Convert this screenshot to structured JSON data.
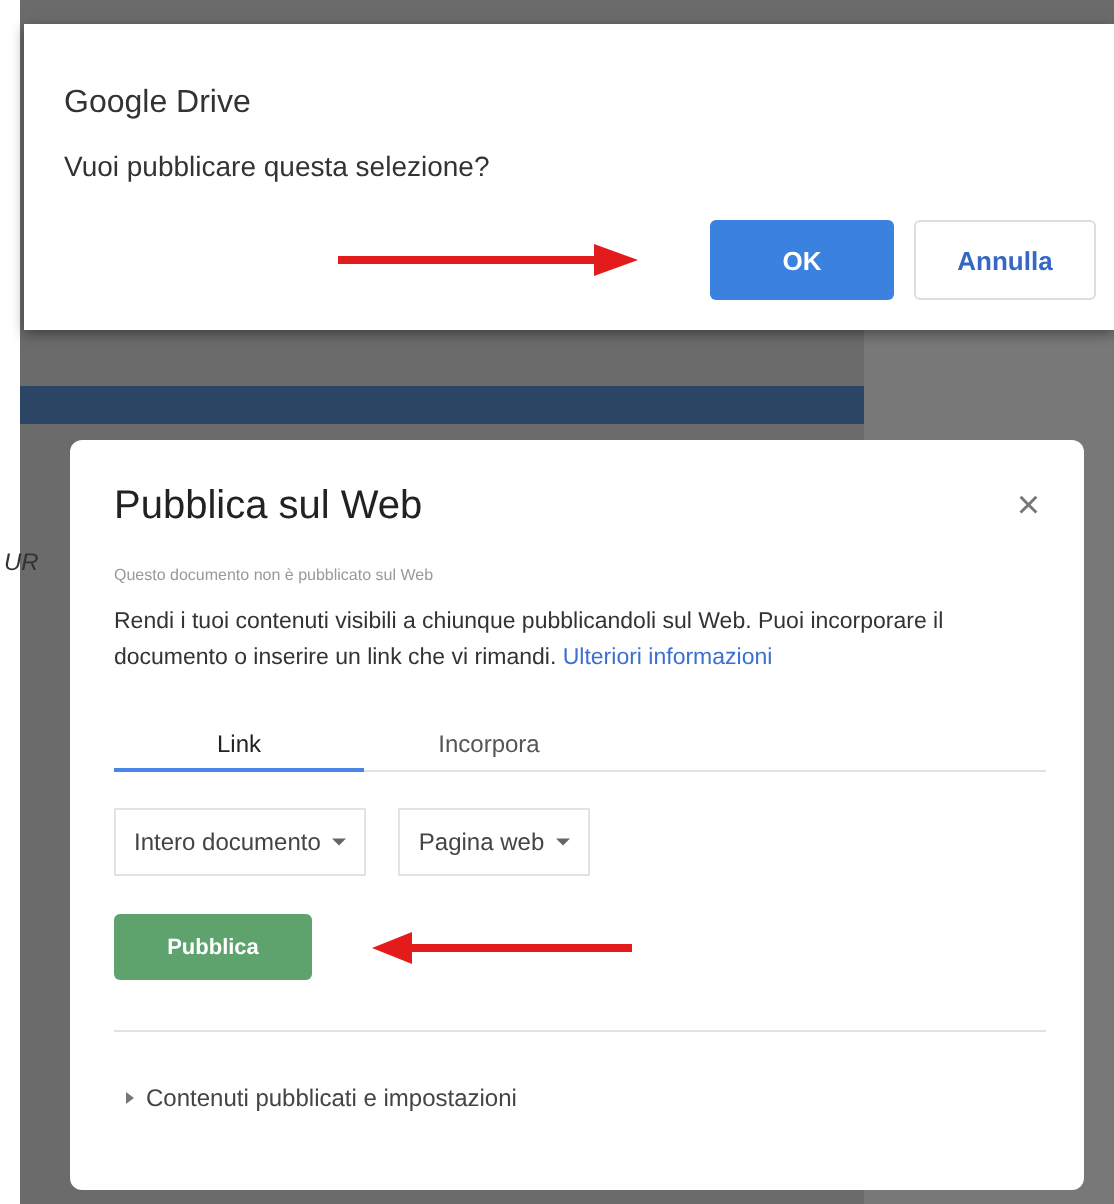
{
  "background": {
    "partial_text": "UR"
  },
  "confirm_dialog": {
    "title": "Google Drive",
    "message": "Vuoi pubblicare questa selezione?",
    "buttons": [
      {
        "label": "OK",
        "kind": "primary"
      },
      {
        "label": "Annulla",
        "kind": "secondary"
      }
    ]
  },
  "publish_dialog": {
    "title": "Pubblica sul Web",
    "close": "×",
    "status": "Questo documento non è pubblicato sul Web",
    "description": "Rendi i tuoi contenuti visibili a chiunque pubblicandoli sul Web. Puoi incorporare il documento o inserire un link che vi rimandi.",
    "link": "Ulteriori informazioni",
    "tabs": [
      {
        "label": "Link",
        "selected": true
      },
      {
        "label": "Incorpora",
        "selected": false
      }
    ],
    "dropdowns": [
      {
        "value": "Intero documento"
      },
      {
        "value": "Pagina web"
      }
    ],
    "publish_button": "Pubblica",
    "section": {
      "label": "Contenuti pubblicati e impostazioni",
      "expanded": false
    }
  }
}
